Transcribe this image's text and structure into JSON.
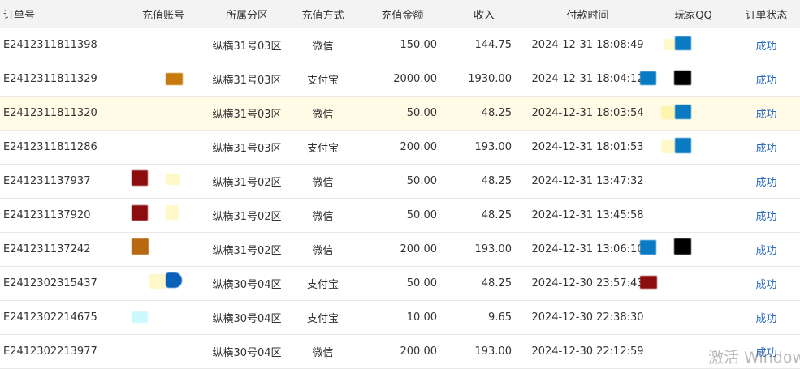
{
  "headers": {
    "order": "订单号",
    "account": "充值账号",
    "zone": "所属分区",
    "method": "充值方式",
    "amount": "充值金额",
    "income": "收入",
    "time": "付款时间",
    "qq": "玩家QQ",
    "status": "订单状态"
  },
  "rows": [
    {
      "order": "E2412311811398",
      "zone": "纵横31号03区",
      "method": "微信",
      "amount": "150.00",
      "income": "144.75",
      "time": "2024-12-31 18:08:49",
      "status": "成功"
    },
    {
      "order": "E2412311811329",
      "zone": "纵横31号03区",
      "method": "支付宝",
      "amount": "2000.00",
      "income": "1930.00",
      "time": "2024-12-31 18:04:12",
      "status": "成功"
    },
    {
      "order": "E2412311811320",
      "zone": "纵横31号03区",
      "method": "微信",
      "amount": "50.00",
      "income": "48.25",
      "time": "2024-12-31 18:03:54",
      "status": "成功"
    },
    {
      "order": "E2412311811286",
      "zone": "纵横31号03区",
      "method": "支付宝",
      "amount": "200.00",
      "income": "193.00",
      "time": "2024-12-31 18:01:53",
      "status": "成功"
    },
    {
      "order": "E241231137937",
      "zone": "纵横31号02区",
      "method": "微信",
      "amount": "50.00",
      "income": "48.25",
      "time": "2024-12-31 13:47:32",
      "status": "成功"
    },
    {
      "order": "E241231137920",
      "zone": "纵横31号02区",
      "method": "微信",
      "amount": "50.00",
      "income": "48.25",
      "time": "2024-12-31 13:45:58",
      "status": "成功"
    },
    {
      "order": "E241231137242",
      "zone": "纵横31号02区",
      "method": "微信",
      "amount": "200.00",
      "income": "193.00",
      "time": "2024-12-31 13:06:10",
      "status": "成功"
    },
    {
      "order": "E2412302315437",
      "zone": "纵横30号04区",
      "method": "支付宝",
      "amount": "50.00",
      "income": "48.25",
      "time": "2024-12-30 23:57:43",
      "status": "成功"
    },
    {
      "order": "E2412302214675",
      "zone": "纵横30号04区",
      "method": "支付宝",
      "amount": "10.00",
      "income": "9.65",
      "time": "2024-12-30 22:38:30",
      "status": "成功"
    },
    {
      "order": "E2412302213977",
      "zone": "纵横30号04区",
      "method": "微信",
      "amount": "200.00",
      "income": "193.00",
      "time": "2024-12-30 22:12:59",
      "status": "成功"
    }
  ],
  "colors": {
    "status_link": "#2a6bc4",
    "highlight_row": "#fffbe6",
    "header_bg": "#f3f3f3",
    "redaction_blue": "#0a7bc2",
    "redaction_red": "#8b0d0d",
    "redaction_orange": "#c87a0e",
    "redaction_yellow": "#fff8c8",
    "redaction_black": "#000000"
  },
  "watermark": "激活 Window"
}
